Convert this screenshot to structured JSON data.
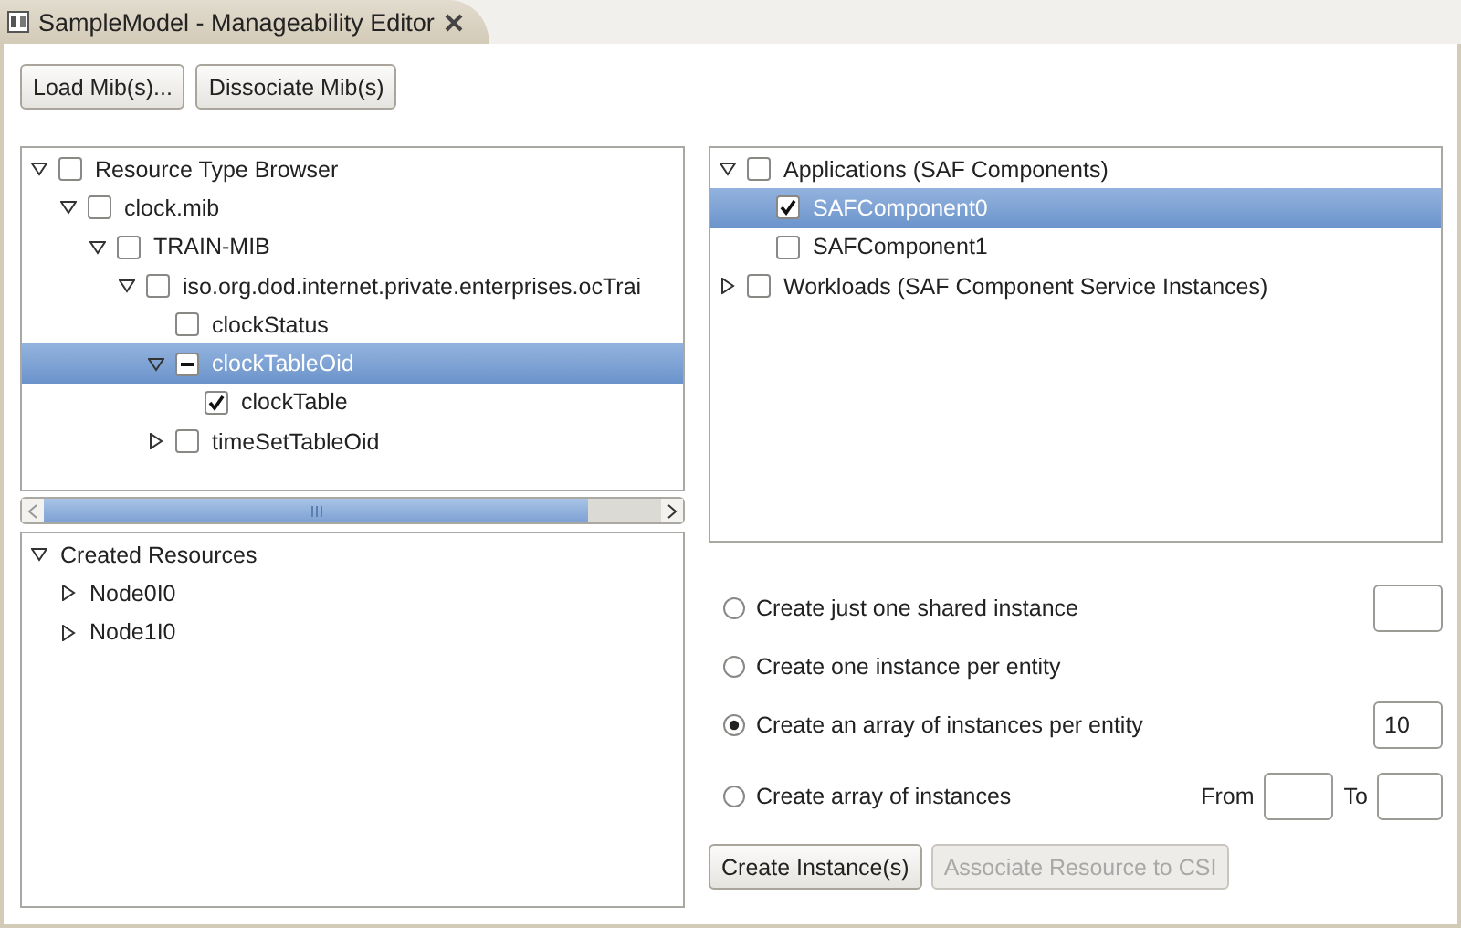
{
  "editor_tab": {
    "title": "SampleModel - Manageability Editor"
  },
  "toolbar_buttons": [
    {
      "label": "Load Mib(s)...",
      "disabled": false
    },
    {
      "label": "Dissociate Mib(s)",
      "disabled": false
    }
  ],
  "resource_tree": {
    "items": [
      {
        "label": "Resource Type Browser",
        "expanded": true,
        "checked": false,
        "selected": false,
        "children": [
          {
            "label": "clock.mib",
            "expanded": true,
            "checked": false,
            "selected": false,
            "children": [
              {
                "label": "TRAIN-MIB",
                "expanded": true,
                "checked": false,
                "selected": false,
                "children": [
                  {
                    "label": "iso.org.dod.internet.private.enterprises.ocTrai",
                    "expanded": true,
                    "checked": false,
                    "selected": false,
                    "children": [
                      {
                        "label": "clockStatus",
                        "checked": false,
                        "selected": false
                      },
                      {
                        "label": "clockTableOid",
                        "expanded": true,
                        "checked": false,
                        "partial": true,
                        "selected": true,
                        "children": [
                          {
                            "label": "clockTable",
                            "checked": true,
                            "selected": false
                          }
                        ]
                      },
                      {
                        "label": "timeSetTableOid",
                        "expanded": false,
                        "checked": false,
                        "selected": false
                      }
                    ]
                  }
                ]
              }
            ]
          }
        ]
      }
    ]
  },
  "created_resources": {
    "items": [
      {
        "label": "Created Resources",
        "expanded": true,
        "selected": false,
        "children": [
          {
            "label": "Node0I0",
            "expanded": false,
            "selected": false
          },
          {
            "label": "Node1I0",
            "expanded": false,
            "selected": false
          }
        ]
      }
    ]
  },
  "component_tree": {
    "items": [
      {
        "label": "Applications (SAF Components)",
        "expanded": true,
        "checked": false,
        "selected": false,
        "children": [
          {
            "label": "SAFComponent0",
            "checked": true,
            "selected": true
          },
          {
            "label": "SAFComponent1",
            "checked": false,
            "selected": false
          }
        ]
      },
      {
        "label": "Workloads (SAF Component Service Instances)",
        "expanded": false,
        "checked": false,
        "selected": false
      }
    ]
  },
  "instance_options": [
    {
      "label": "Create just one shared instance",
      "selected": false,
      "fields": [
        {
          "kind": "input"
        }
      ]
    },
    {
      "label": "Create one instance per entity",
      "selected": false
    },
    {
      "label": "Create an array of instances per entity",
      "selected": true,
      "fields": [
        {
          "kind": "input",
          "value": "10"
        }
      ]
    },
    {
      "label": "Create array of instances",
      "selected": false,
      "fields": [
        {
          "kind": "input",
          "label": "From"
        },
        {
          "kind": "input",
          "label": "To"
        }
      ]
    }
  ],
  "action_buttons": [
    {
      "label": "Create Instance(s)",
      "disabled": false
    },
    {
      "label": "Associate Resource to CSI",
      "disabled": true
    }
  ]
}
